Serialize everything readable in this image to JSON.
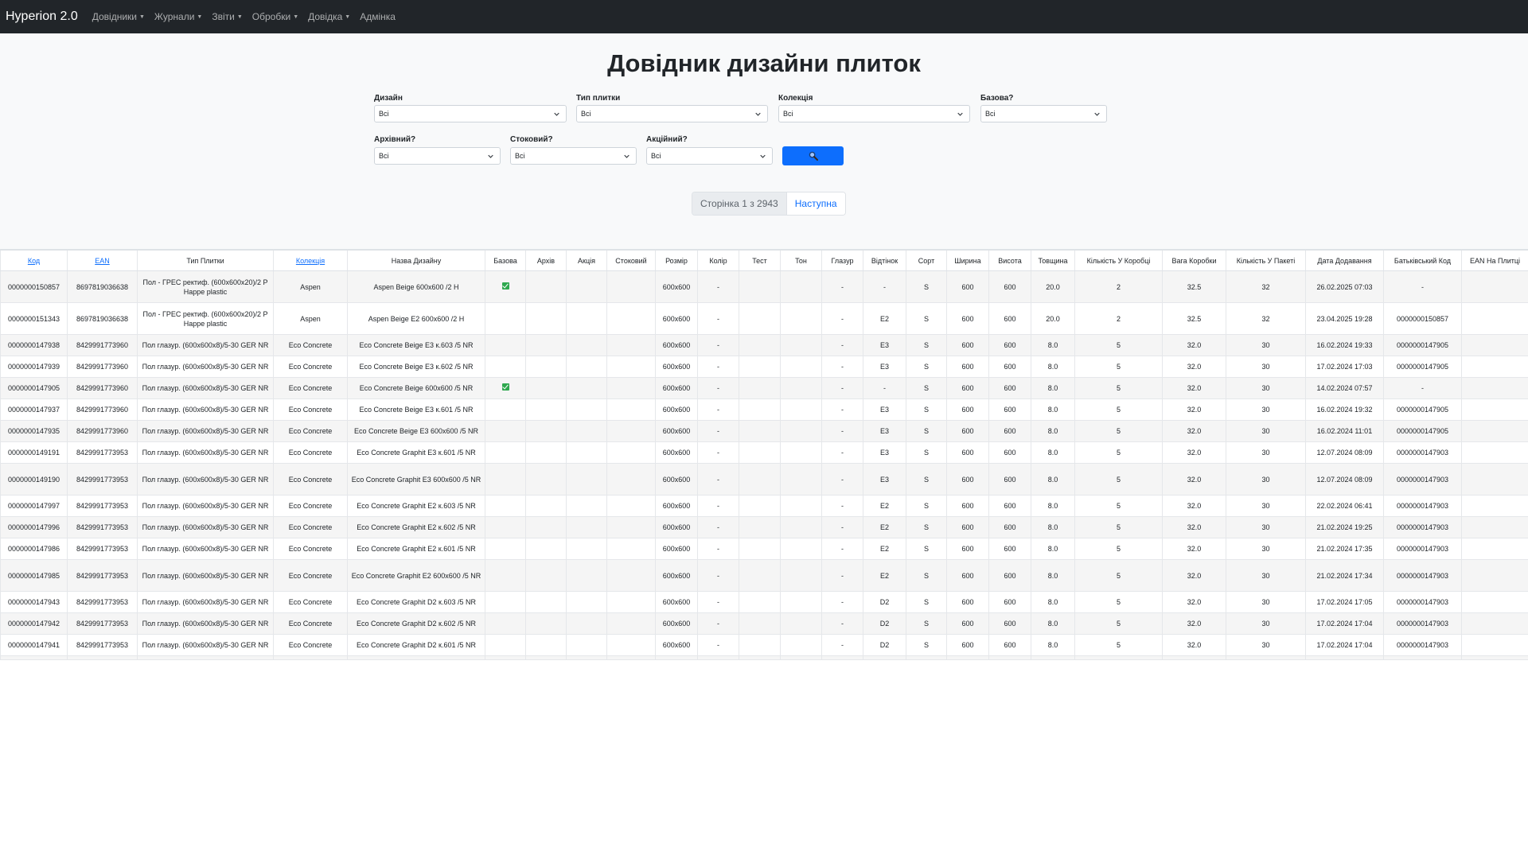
{
  "app": {
    "brand": "Hyperion 2.0"
  },
  "nav": [
    {
      "label": "Довідники",
      "dropdown": true
    },
    {
      "label": "Журнали",
      "dropdown": true
    },
    {
      "label": "Звіти",
      "dropdown": true
    },
    {
      "label": "Обробки",
      "dropdown": true
    },
    {
      "label": "Довідка",
      "dropdown": true
    },
    {
      "label": "Адмінка",
      "dropdown": false
    }
  ],
  "page": {
    "title": "Довідник дизайни плиток"
  },
  "filters": {
    "design": {
      "label": "Дизайн",
      "value": "Всі"
    },
    "tile_type": {
      "label": "Тип плитки",
      "value": "Всі"
    },
    "collection": {
      "label": "Колекція",
      "value": "Всі"
    },
    "base": {
      "label": "Базова?",
      "value": "Всі"
    },
    "archive": {
      "label": "Архівний?",
      "value": "Всі"
    },
    "stock": {
      "label": "Стоковий?",
      "value": "Всі"
    },
    "promo": {
      "label": "Акційний?",
      "value": "Всі"
    },
    "search_icon": "magnifier-icon"
  },
  "pagination": {
    "info": "Сторінка 1 з 2943",
    "next": "Наступна"
  },
  "table": {
    "headers": [
      "Код",
      "EAN",
      "Тип Плитки",
      "Колекція",
      "Назва Дизайну",
      "Базова",
      "Архів",
      "Акція",
      "Стоковий",
      "Розмір",
      "Колір",
      "Тест",
      "Тон",
      "Глазур",
      "Відтінок",
      "Сорт",
      "Ширина",
      "Висота",
      "Товщина",
      "Кількість У Коробці",
      "Вага Коробки",
      "Кількість У Пакеті",
      "Дата Додавання",
      "Батьківський Код",
      "EAN На Плитці"
    ],
    "sortable": [
      true,
      true,
      false,
      true,
      false,
      false,
      false,
      false,
      false,
      false,
      false,
      false,
      false,
      false,
      false,
      false,
      false,
      false,
      false,
      false,
      false,
      false,
      false,
      false,
      false
    ],
    "rows": [
      {
        "tall": true,
        "base": true,
        "cells": [
          "0000000150857",
          "8697819036638",
          "Пол - ГРЕС ректиф. (600x600x20)/2 P Happe plastic",
          "Aspen",
          "Aspen Beige 600x600 /2 H",
          "",
          "",
          "",
          "",
          "600x600",
          "-",
          "",
          "",
          "-",
          "-",
          "S",
          "600",
          "600",
          "20.0",
          "2",
          "32.5",
          "32",
          "26.02.2025 07:03",
          "-",
          ""
        ]
      },
      {
        "tall": true,
        "base": false,
        "cells": [
          "0000000151343",
          "8697819036638",
          "Пол - ГРЕС ректиф. (600x600x20)/2 P Happe plastic",
          "Aspen",
          "Aspen Beige E2 600x600 /2 H",
          "",
          "",
          "",
          "",
          "600x600",
          "-",
          "",
          "",
          "-",
          "E2",
          "S",
          "600",
          "600",
          "20.0",
          "2",
          "32.5",
          "32",
          "23.04.2025 19:28",
          "0000000150857",
          ""
        ]
      },
      {
        "tall": false,
        "base": false,
        "cells": [
          "0000000147938",
          "8429991773960",
          "Пол глазур. (600x600x8)/5-30 GER NR",
          "Eco Concrete",
          "Eco Concrete Beige E3 к.603 /5 NR",
          "",
          "",
          "",
          "",
          "600x600",
          "-",
          "",
          "",
          "-",
          "E3",
          "S",
          "600",
          "600",
          "8.0",
          "5",
          "32.0",
          "30",
          "16.02.2024 19:33",
          "0000000147905",
          ""
        ]
      },
      {
        "tall": false,
        "base": false,
        "cells": [
          "0000000147939",
          "8429991773960",
          "Пол глазур. (600x600x8)/5-30 GER NR",
          "Eco Concrete",
          "Eco Concrete Beige E3 к.602 /5 NR",
          "",
          "",
          "",
          "",
          "600x600",
          "-",
          "",
          "",
          "-",
          "E3",
          "S",
          "600",
          "600",
          "8.0",
          "5",
          "32.0",
          "30",
          "17.02.2024 17:03",
          "0000000147905",
          ""
        ]
      },
      {
        "tall": false,
        "base": true,
        "cells": [
          "0000000147905",
          "8429991773960",
          "Пол глазур. (600x600x8)/5-30 GER NR",
          "Eco Concrete",
          "Eco Concrete Beige 600x600 /5 NR",
          "",
          "",
          "",
          "",
          "600x600",
          "-",
          "",
          "",
          "-",
          "-",
          "S",
          "600",
          "600",
          "8.0",
          "5",
          "32.0",
          "30",
          "14.02.2024 07:57",
          "-",
          ""
        ]
      },
      {
        "tall": false,
        "base": false,
        "cells": [
          "0000000147937",
          "8429991773960",
          "Пол глазур. (600x600x8)/5-30 GER NR",
          "Eco Concrete",
          "Eco Concrete Beige E3 к.601 /5 NR",
          "",
          "",
          "",
          "",
          "600x600",
          "-",
          "",
          "",
          "-",
          "E3",
          "S",
          "600",
          "600",
          "8.0",
          "5",
          "32.0",
          "30",
          "16.02.2024 19:32",
          "0000000147905",
          ""
        ]
      },
      {
        "tall": false,
        "base": false,
        "cells": [
          "0000000147935",
          "8429991773960",
          "Пол глазур. (600x600x8)/5-30 GER NR",
          "Eco Concrete",
          "Eco Concrete Beige E3 600x600 /5 NR",
          "",
          "",
          "",
          "",
          "600x600",
          "-",
          "",
          "",
          "-",
          "E3",
          "S",
          "600",
          "600",
          "8.0",
          "5",
          "32.0",
          "30",
          "16.02.2024 11:01",
          "0000000147905",
          ""
        ]
      },
      {
        "tall": false,
        "base": false,
        "cells": [
          "0000000149191",
          "8429991773953",
          "Пол глазур. (600x600x8)/5-30 GER NR",
          "Eco Concrete",
          "Eco Concrete Graphit E3 к.601 /5 NR",
          "",
          "",
          "",
          "",
          "600x600",
          "-",
          "",
          "",
          "-",
          "E3",
          "S",
          "600",
          "600",
          "8.0",
          "5",
          "32.0",
          "30",
          "12.07.2024 08:09",
          "0000000147903",
          ""
        ]
      },
      {
        "tall": true,
        "base": false,
        "cells": [
          "0000000149190",
          "8429991773953",
          "Пол глазур. (600x600x8)/5-30 GER NR",
          "Eco Concrete",
          "Eco Concrete Graphit E3 600x600 /5 NR",
          "",
          "",
          "",
          "",
          "600x600",
          "-",
          "",
          "",
          "-",
          "E3",
          "S",
          "600",
          "600",
          "8.0",
          "5",
          "32.0",
          "30",
          "12.07.2024 08:09",
          "0000000147903",
          ""
        ]
      },
      {
        "tall": false,
        "base": false,
        "cells": [
          "0000000147997",
          "8429991773953",
          "Пол глазур. (600x600x8)/5-30 GER NR",
          "Eco Concrete",
          "Eco Concrete Graphit E2 к.603 /5 NR",
          "",
          "",
          "",
          "",
          "600x600",
          "-",
          "",
          "",
          "-",
          "E2",
          "S",
          "600",
          "600",
          "8.0",
          "5",
          "32.0",
          "30",
          "22.02.2024 06:41",
          "0000000147903",
          ""
        ]
      },
      {
        "tall": false,
        "base": false,
        "cells": [
          "0000000147996",
          "8429991773953",
          "Пол глазур. (600x600x8)/5-30 GER NR",
          "Eco Concrete",
          "Eco Concrete Graphit E2 к.602 /5 NR",
          "",
          "",
          "",
          "",
          "600x600",
          "-",
          "",
          "",
          "-",
          "E2",
          "S",
          "600",
          "600",
          "8.0",
          "5",
          "32.0",
          "30",
          "21.02.2024 19:25",
          "0000000147903",
          ""
        ]
      },
      {
        "tall": false,
        "base": false,
        "cells": [
          "0000000147986",
          "8429991773953",
          "Пол глазур. (600x600x8)/5-30 GER NR",
          "Eco Concrete",
          "Eco Concrete Graphit E2 к.601 /5 NR",
          "",
          "",
          "",
          "",
          "600x600",
          "-",
          "",
          "",
          "-",
          "E2",
          "S",
          "600",
          "600",
          "8.0",
          "5",
          "32.0",
          "30",
          "21.02.2024 17:35",
          "0000000147903",
          ""
        ]
      },
      {
        "tall": true,
        "base": false,
        "cells": [
          "0000000147985",
          "8429991773953",
          "Пол глазур. (600x600x8)/5-30 GER NR",
          "Eco Concrete",
          "Eco Concrete Graphit E2 600x600 /5 NR",
          "",
          "",
          "",
          "",
          "600x600",
          "-",
          "",
          "",
          "-",
          "E2",
          "S",
          "600",
          "600",
          "8.0",
          "5",
          "32.0",
          "30",
          "21.02.2024 17:34",
          "0000000147903",
          ""
        ]
      },
      {
        "tall": false,
        "base": false,
        "cells": [
          "0000000147943",
          "8429991773953",
          "Пол глазур. (600x600x8)/5-30 GER NR",
          "Eco Concrete",
          "Eco Concrete Graphit D2 к.603 /5 NR",
          "",
          "",
          "",
          "",
          "600x600",
          "-",
          "",
          "",
          "-",
          "D2",
          "S",
          "600",
          "600",
          "8.0",
          "5",
          "32.0",
          "30",
          "17.02.2024 17:05",
          "0000000147903",
          ""
        ]
      },
      {
        "tall": false,
        "base": false,
        "cells": [
          "0000000147942",
          "8429991773953",
          "Пол глазур. (600x600x8)/5-30 GER NR",
          "Eco Concrete",
          "Eco Concrete Graphit D2 к.602 /5 NR",
          "",
          "",
          "",
          "",
          "600x600",
          "-",
          "",
          "",
          "-",
          "D2",
          "S",
          "600",
          "600",
          "8.0",
          "5",
          "32.0",
          "30",
          "17.02.2024 17:04",
          "0000000147903",
          ""
        ]
      },
      {
        "tall": false,
        "base": false,
        "cells": [
          "0000000147941",
          "8429991773953",
          "Пол глазур. (600x600x8)/5-30 GER NR",
          "Eco Concrete",
          "Eco Concrete Graphit D2 к.601 /5 NR",
          "",
          "",
          "",
          "",
          "600x600",
          "-",
          "",
          "",
          "-",
          "D2",
          "S",
          "600",
          "600",
          "8.0",
          "5",
          "32.0",
          "30",
          "17.02.2024 17:04",
          "0000000147903",
          ""
        ]
      }
    ]
  },
  "colors": {
    "navbar": "#212529",
    "primary": "#0d6efd",
    "check": "#2fa84f",
    "page_bg": "#f8f9fa"
  }
}
